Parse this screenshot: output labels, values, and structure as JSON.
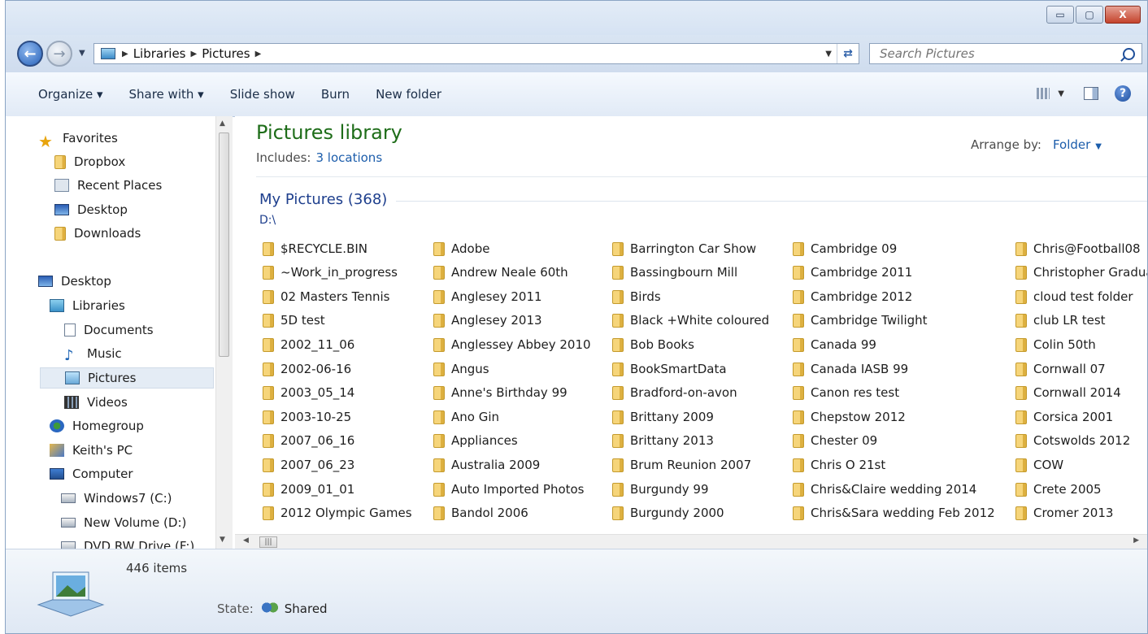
{
  "window": {
    "controls": {
      "minimize": "▭",
      "maximize": "▢",
      "close": "X"
    }
  },
  "address": {
    "crumbs": [
      "Libraries",
      "Pictures"
    ],
    "search_placeholder": "Search Pictures"
  },
  "toolbar": {
    "organize": "Organize ▾",
    "share_with": "Share with ▾",
    "slide_show": "Slide show",
    "burn": "Burn",
    "new_folder": "New folder"
  },
  "nav": {
    "items": [
      {
        "label": "Favorites",
        "icon": "star-icon"
      },
      {
        "label": "Dropbox",
        "icon": "folder-icon"
      },
      {
        "label": "Recent Places",
        "icon": "recent-places-icon"
      },
      {
        "label": "Desktop",
        "icon": "desktop-icon"
      },
      {
        "label": "Downloads",
        "icon": "downloads-folder-icon"
      },
      {
        "label": "Desktop",
        "icon": "desktop-icon"
      },
      {
        "label": "Libraries",
        "icon": "libraries-icon"
      },
      {
        "label": "Documents",
        "icon": "documents-icon"
      },
      {
        "label": "Music",
        "icon": "music-icon"
      },
      {
        "label": "Pictures",
        "icon": "pictures-icon"
      },
      {
        "label": "Videos",
        "icon": "videos-icon"
      },
      {
        "label": "Homegroup",
        "icon": "homegroup-icon"
      },
      {
        "label": "Keith's PC",
        "icon": "user-pc-icon"
      },
      {
        "label": "Computer",
        "icon": "computer-icon"
      },
      {
        "label": "Windows7 (C:)",
        "icon": "drive-icon"
      },
      {
        "label": "New Volume (D:)",
        "icon": "drive-icon"
      },
      {
        "label": "DVD RW Drive (F:)",
        "icon": "dvd-drive-icon"
      }
    ],
    "selected": "Pictures"
  },
  "library": {
    "title": "Pictures library",
    "includes_label": "Includes:",
    "includes_link": "3 locations",
    "arrange_label": "Arrange by:",
    "arrange_value": "Folder"
  },
  "group": {
    "title": "My Pictures (368)",
    "path": "D:\\"
  },
  "folders": {
    "col1": [
      "$RECYCLE.BIN",
      "~Work_in_progress",
      "02 Masters Tennis",
      "5D test",
      "2002_11_06",
      "2002-06-16",
      "2003_05_14",
      "2003-10-25",
      "2007_06_16",
      "2007_06_23",
      "2009_01_01",
      "2012 Olympic Games"
    ],
    "col2": [
      "Adobe",
      "Andrew Neale 60th",
      "Anglesey 2011",
      "Anglesey 2013",
      "Anglessey Abbey 2010",
      "Angus",
      "Anne's Birthday 99",
      "Ano Gin",
      "Appliances",
      "Australia 2009",
      "Auto Imported Photos",
      "Bandol 2006"
    ],
    "col3": [
      "Barrington Car Show",
      "Bassingbourn Mill",
      "Birds",
      "Black +White coloured",
      "Bob Books",
      "BookSmartData",
      "Bradford-on-avon",
      "Brittany 2009",
      "Brittany 2013",
      "Brum Reunion 2007",
      "Burgundy 99",
      "Burgundy 2000"
    ],
    "col4": [
      "Cambridge 09",
      "Cambridge 2011",
      "Cambridge 2012",
      "Cambridge Twilight",
      "Canada 99",
      "Canada IASB 99",
      "Canon res test",
      "Chepstow 2012",
      "Chester 09",
      "Chris O 21st",
      "Chris&Claire wedding 2014",
      "Chris&Sara wedding Feb 2012"
    ],
    "col5": [
      "Chris@Football08",
      "Christopher Gradua",
      "cloud test folder",
      "club LR test",
      "Colin 50th",
      "Cornwall 07",
      "Cornwall 2014",
      "Corsica 2001",
      "Cotswolds 2012",
      "COW",
      "Crete 2005",
      "Cromer 2013"
    ]
  },
  "details": {
    "count": "446 items",
    "state_label": "State:",
    "state_value": "Shared"
  }
}
